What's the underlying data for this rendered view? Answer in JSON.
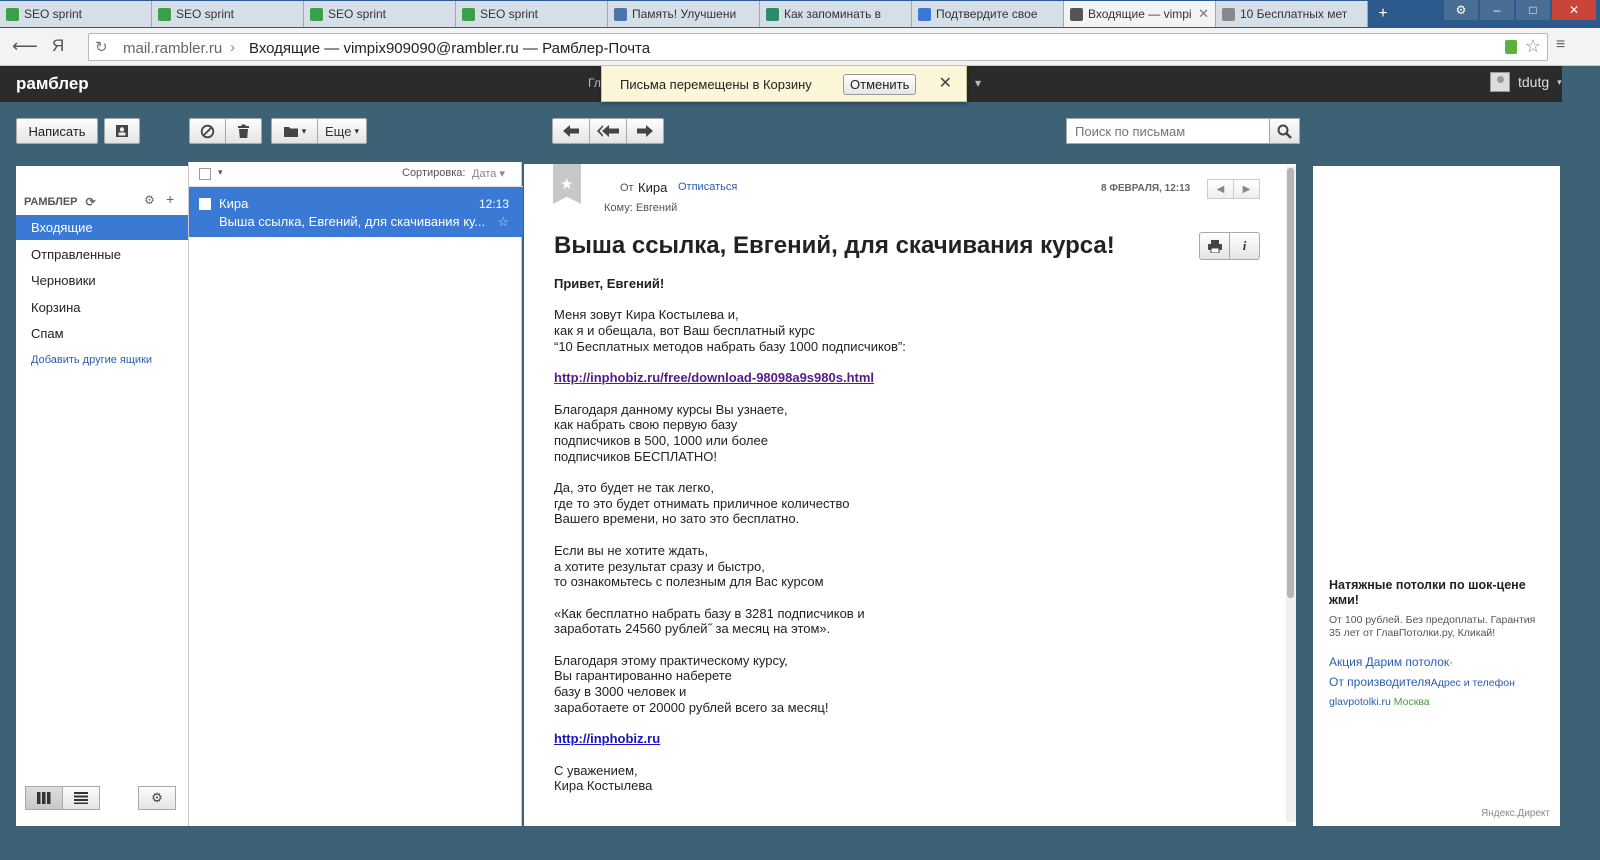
{
  "browser": {
    "tabs": [
      {
        "title": "SEO sprint",
        "icon": "seo-sprint-icon",
        "color": "#3aa14a"
      },
      {
        "title": "SEO sprint",
        "icon": "seo-sprint-icon",
        "color": "#3aa14a"
      },
      {
        "title": "SEO sprint",
        "icon": "seo-sprint-icon",
        "color": "#3aa14a"
      },
      {
        "title": "SEO sprint",
        "icon": "seo-sprint-icon",
        "color": "#3aa14a"
      },
      {
        "title": "Память! Улучшени",
        "icon": "vk-icon",
        "color": "#4a76a8"
      },
      {
        "title": "Как запоминать в",
        "icon": "jc-icon",
        "color": "#2a8a6a"
      },
      {
        "title": "Подтвердите свое",
        "icon": "chrome-icon",
        "color": "#3a7ad4"
      },
      {
        "title": "Входящие — vimpi",
        "icon": "mail-icon",
        "color": "#555555",
        "active": true
      },
      {
        "title": "10 Бесплатных мет",
        "icon": "page-icon",
        "color": "#888888"
      }
    ],
    "url_host": "mail.rambler.ru",
    "url_title": "Входящие — vimpix909090@rambler.ru — Рамблер-Почта",
    "ya": "Я"
  },
  "header": {
    "logo": "рамблер",
    "nav_partial": "Гл",
    "username": "tdutg"
  },
  "toast": {
    "text": "Письма перемещены в Корзину",
    "undo": "Отменить"
  },
  "toolbar": {
    "compose": "Написать",
    "more": "Еще",
    "search_placeholder": "Поиск по письмам"
  },
  "sidebar": {
    "account": "РАМБЛЕР",
    "folders": [
      {
        "label": "Входящие",
        "active": true
      },
      {
        "label": "Отправленные"
      },
      {
        "label": "Черновики"
      },
      {
        "label": "Корзина"
      },
      {
        "label": "Спам"
      }
    ],
    "add_mailbox": "Добавить другие ящики"
  },
  "list": {
    "sort_label": "Сортировка:",
    "sort_value": "Дата",
    "messages": [
      {
        "from": "Кира",
        "time": "12:13",
        "subject": "Выша ссылка, Евгений, для скачивания ку..."
      }
    ]
  },
  "reader": {
    "from_label": "От",
    "from_name": "Кира",
    "unsubscribe": "Отписаться",
    "to_line": "Кому: Евгений",
    "date": "8 ФЕВРАЛЯ, 12:13",
    "subject": "Выша ссылка, Евгений, для скачивания курса!",
    "greeting": "Привет, Евгений!",
    "paragraphs": [
      [
        "Меня зовут Кира Костылева и,",
        "как я и обещала, вот Ваш бесплатный курс",
        "“10 Бесплатных методов набрать базу 1000 подписчиков”:"
      ],
      [
        "Благодаря данному курсы Вы узнаете,",
        "как набрать свою первую базу",
        "подписчиков в 500, 1000 или более",
        "подписчиков БЕСПЛАТНО!"
      ],
      [
        "Да, это будет не так легко,",
        "где то это будет отнимать приличное количество",
        "Вашего времени, но зато это бесплатно."
      ],
      [
        "Если вы не хотите ждать,",
        "а хотите результат сразу и быстро,",
        "то ознакомьтесь с полезным для Вас курсом"
      ],
      [
        "«Как бесплатно набрать базу в 3281 подписчиков и",
        "заработать 24560 рублей˝ за месяц на этом»."
      ],
      [
        "Благодаря этому практическому курсу,",
        "Вы гарантированно наберете",
        "базу в 3000 человек и",
        "заработаете от 20000 рублей всего за месяц!"
      ]
    ],
    "link1": "http://inphobiz.ru/free/download-98098a9s980s.html",
    "link2": "http://inphobiz.ru",
    "signoff": [
      "С уважением,",
      "Кира Костылева"
    ]
  },
  "ad": {
    "title": "Натяжные потолки по шок-цене жми!",
    "text": "От 100 рублей. Без предоплаты. Гарантия 35 лет от ГлавПотолки.ру, Кликай!",
    "link1": "Акция Дарим потолок·",
    "link2": "От производителя",
    "link2_extra": "Адрес и телефон",
    "domain": "glavpotolki.ru",
    "city": "Москва",
    "footer": "Яндекс.Директ"
  }
}
